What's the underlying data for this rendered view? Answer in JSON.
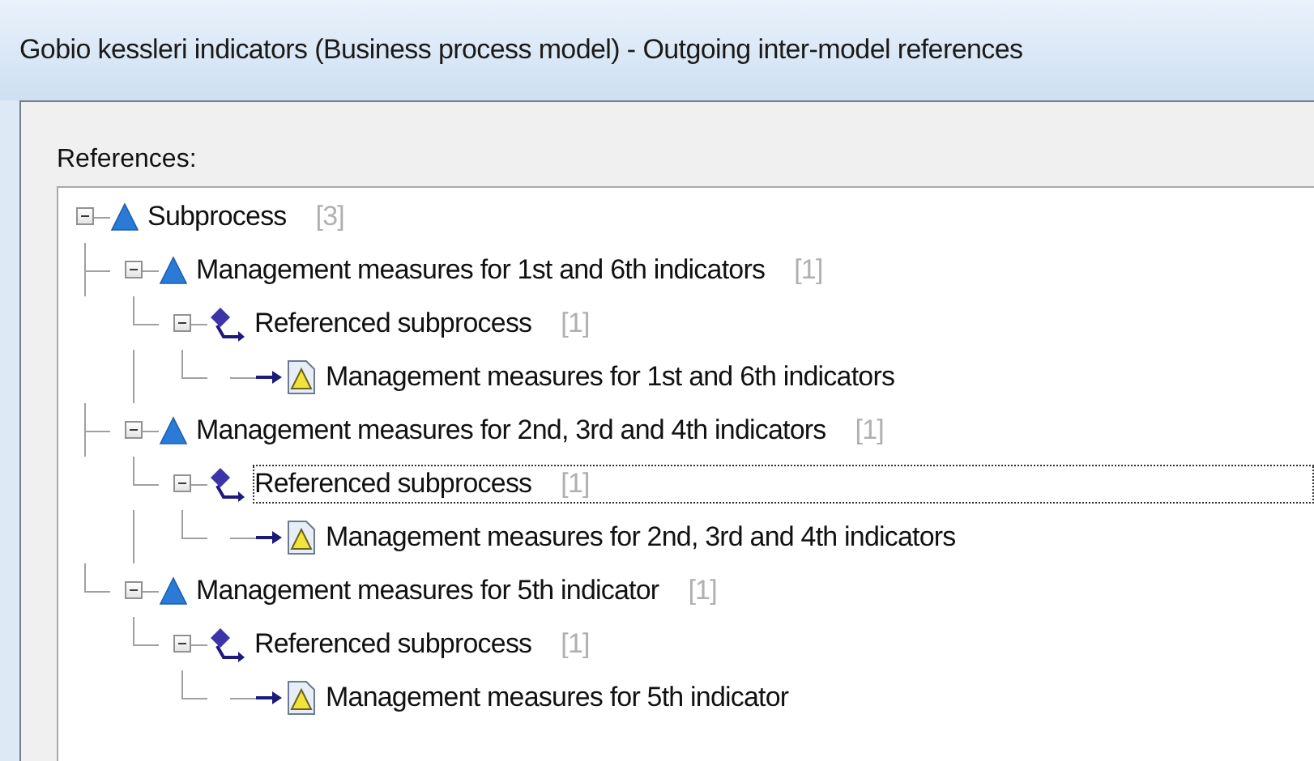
{
  "window": {
    "title": "Gobio kessleri indicators (Business process model) - Outgoing inter-model references"
  },
  "references_label": "References:",
  "tree": [
    {
      "kind": "subprocess",
      "label": "Subprocess",
      "count": "[3]",
      "expanded": true,
      "focused": false,
      "children": [
        {
          "kind": "subprocess",
          "label": "Management measures for 1st and 6th indicators",
          "count": "[1]",
          "expanded": true,
          "focused": false,
          "children": [
            {
              "kind": "reference",
              "label": "Referenced subprocess",
              "count": "[1]",
              "expanded": true,
              "focused": false,
              "children": [
                {
                  "kind": "target",
                  "label": "Management measures for 1st and 6th indicators",
                  "focused": false
                }
              ]
            }
          ]
        },
        {
          "kind": "subprocess",
          "label": "Management measures for 2nd, 3rd and 4th indicators",
          "count": "[1]",
          "expanded": true,
          "focused": false,
          "children": [
            {
              "kind": "reference",
              "label": "Referenced subprocess",
              "count": "[1]",
              "expanded": true,
              "focused": true,
              "children": [
                {
                  "kind": "target",
                  "label": "Management measures for 2nd, 3rd and 4th indicators",
                  "focused": false
                }
              ]
            }
          ]
        },
        {
          "kind": "subprocess",
          "label": "Management measures for 5th indicator",
          "count": "[1]",
          "expanded": true,
          "focused": false,
          "children": [
            {
              "kind": "reference",
              "label": "Referenced subprocess",
              "count": "[1]",
              "expanded": true,
              "focused": false,
              "children": [
                {
                  "kind": "target",
                  "label": "Management measures for 5th indicator",
                  "focused": false
                }
              ]
            }
          ]
        }
      ]
    }
  ]
}
